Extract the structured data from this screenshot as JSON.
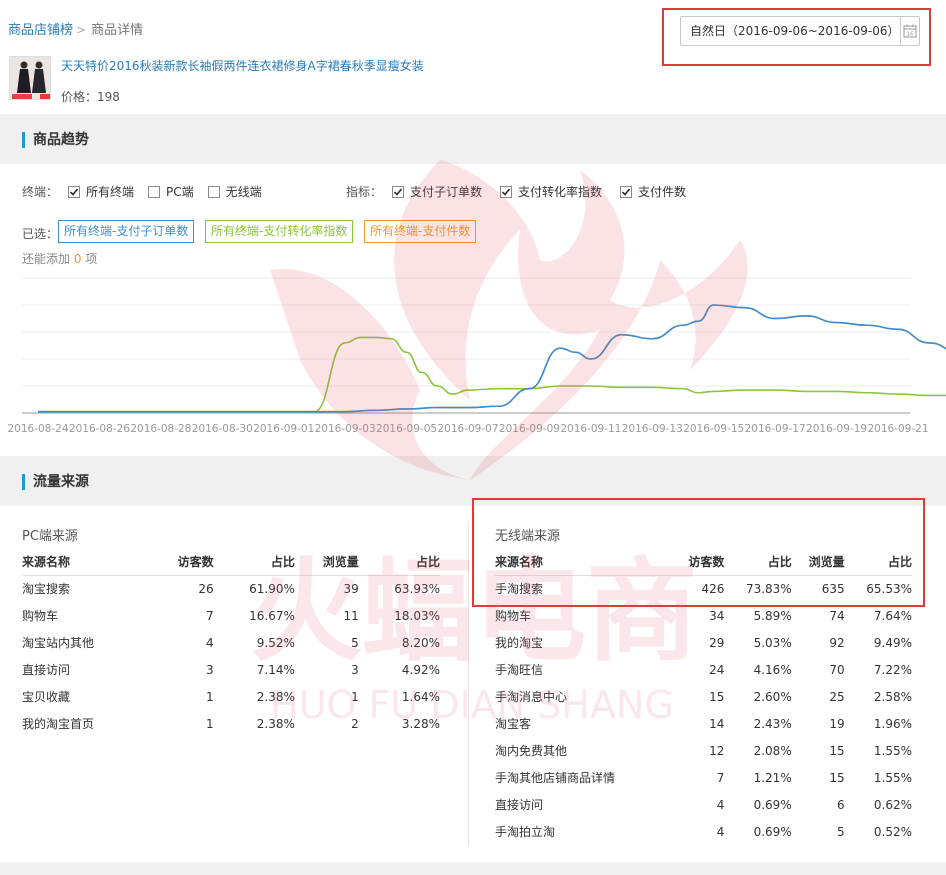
{
  "breadcrumb": {
    "root": "商品店铺榜",
    "separator": ">",
    "current": "商品详情"
  },
  "date_picker": {
    "value": "自然日（2016-09-06~2016-09-06）",
    "icon": "calendar-icon",
    "icon_text": "16"
  },
  "product": {
    "title": "天天特价2016秋装新款长袖假两件连衣裙修身A字裙春秋季显瘦女装",
    "price_label": "价格：",
    "price": "198"
  },
  "trend": {
    "section_title": "商品趋势",
    "terminal_label": "终端：",
    "terminals": [
      {
        "label": "所有终端",
        "checked": true
      },
      {
        "label": "PC端",
        "checked": false
      },
      {
        "label": "无线端",
        "checked": false
      }
    ],
    "metric_label": "指标：",
    "metrics": [
      {
        "label": "支付子订单数",
        "checked": true
      },
      {
        "label": "支付转化率指数",
        "checked": true
      },
      {
        "label": "支付件数",
        "checked": true
      }
    ],
    "selected_label": "已选：",
    "selected_tags": [
      {
        "label": "所有终端-支付子订单数",
        "color": "#3a8fd6"
      },
      {
        "label": "所有终端-支付转化率指数",
        "color": "#8cc43c"
      },
      {
        "label": "所有终端-支付件数",
        "color": "#f29b28"
      }
    ],
    "hint_before": "还能添加",
    "hint_count": "0",
    "hint_after": "项"
  },
  "chart_data": {
    "type": "line",
    "x_tick_labels": [
      "2016-08-24",
      "2016-08-26",
      "2016-08-28",
      "2016-08-30",
      "2016-09-01",
      "2016-09-03",
      "2016-09-05",
      "2016-09-07",
      "2016-09-09",
      "2016-09-11",
      "2016-09-13",
      "2016-09-15",
      "2016-09-17",
      "2016-09-19",
      "2016-09-21"
    ],
    "ylim": [
      0,
      100
    ],
    "grid": true,
    "series": [
      {
        "color": "#3a8fd6",
        "x": [
          0,
          6,
          8,
          10,
          11,
          12,
          13,
          14,
          15,
          16,
          17,
          17.5,
          18,
          19,
          20,
          21,
          21.5,
          22,
          23,
          24,
          25,
          26,
          27,
          28,
          29,
          30
        ],
        "values": [
          1,
          1,
          1,
          1,
          2,
          3,
          4,
          4,
          5,
          18,
          48,
          45,
          40,
          58,
          55,
          65,
          68,
          80,
          78,
          70,
          72,
          67,
          65,
          62,
          52,
          45
        ]
      },
      {
        "color": "#f29b28",
        "x": [
          0,
          6,
          8,
          10,
          11,
          12,
          13,
          14,
          15,
          16,
          17,
          17.5,
          18,
          19,
          20,
          21,
          21.5,
          22,
          23,
          24,
          25,
          26,
          27,
          28,
          29,
          30
        ],
        "values": [
          1,
          1,
          1,
          1,
          2,
          3,
          4,
          4,
          5,
          18,
          48,
          45,
          40,
          58,
          55,
          65,
          68,
          80,
          78,
          70,
          72,
          67,
          65,
          62,
          52,
          45
        ]
      },
      {
        "color": "#8cc43c",
        "x": [
          0,
          6,
          8,
          9,
          10,
          10.5,
          11,
          11.5,
          12,
          12.5,
          13,
          13.5,
          14,
          15,
          16,
          17,
          18,
          19,
          20,
          21,
          21.5,
          22,
          23,
          24,
          25,
          26,
          27,
          28,
          29,
          30
        ],
        "values": [
          1,
          1,
          1,
          1,
          52,
          56,
          56,
          55,
          45,
          30,
          20,
          14,
          17,
          18,
          18,
          20,
          20,
          19,
          19,
          18,
          15,
          16,
          17,
          17,
          16,
          16,
          15,
          14,
          13,
          13
        ]
      }
    ]
  },
  "traffic": {
    "section_title": "流量来源",
    "pc": {
      "title": "PC端来源",
      "columns": [
        "来源名称",
        "访客数",
        "占比",
        "浏览量",
        "占比"
      ],
      "rows": [
        [
          "淘宝搜索",
          "26",
          "61.90%",
          "39",
          "63.93%"
        ],
        [
          "购物车",
          "7",
          "16.67%",
          "11",
          "18.03%"
        ],
        [
          "淘宝站内其他",
          "4",
          "9.52%",
          "5",
          "8.20%"
        ],
        [
          "直接访问",
          "3",
          "7.14%",
          "3",
          "4.92%"
        ],
        [
          "宝贝收藏",
          "1",
          "2.38%",
          "1",
          "1.64%"
        ],
        [
          "我的淘宝首页",
          "1",
          "2.38%",
          "2",
          "3.28%"
        ]
      ]
    },
    "mobile": {
      "title": "无线端来源",
      "columns": [
        "来源名称",
        "访客数",
        "占比",
        "浏览量",
        "占比"
      ],
      "rows": [
        [
          "手淘搜索",
          "426",
          "73.83%",
          "635",
          "65.53%"
        ],
        [
          "购物车",
          "34",
          "5.89%",
          "74",
          "7.64%"
        ],
        [
          "我的淘宝",
          "29",
          "5.03%",
          "92",
          "9.49%"
        ],
        [
          "手淘旺信",
          "24",
          "4.16%",
          "70",
          "7.22%"
        ],
        [
          "手淘消息中心",
          "15",
          "2.60%",
          "25",
          "2.58%"
        ],
        [
          "淘宝客",
          "14",
          "2.43%",
          "19",
          "1.96%"
        ],
        [
          "淘内免费其他",
          "12",
          "2.08%",
          "15",
          "1.55%"
        ],
        [
          "手淘其他店铺商品详情",
          "7",
          "1.21%",
          "15",
          "1.55%"
        ],
        [
          "直接访问",
          "4",
          "0.69%",
          "6",
          "0.62%"
        ],
        [
          "手淘拍立淘",
          "4",
          "0.69%",
          "5",
          "0.52%"
        ]
      ]
    }
  },
  "watermark": {
    "line1": "火蝠电商",
    "line2": "HUO FU DIAN SHANG",
    "color": "#e8505b"
  }
}
